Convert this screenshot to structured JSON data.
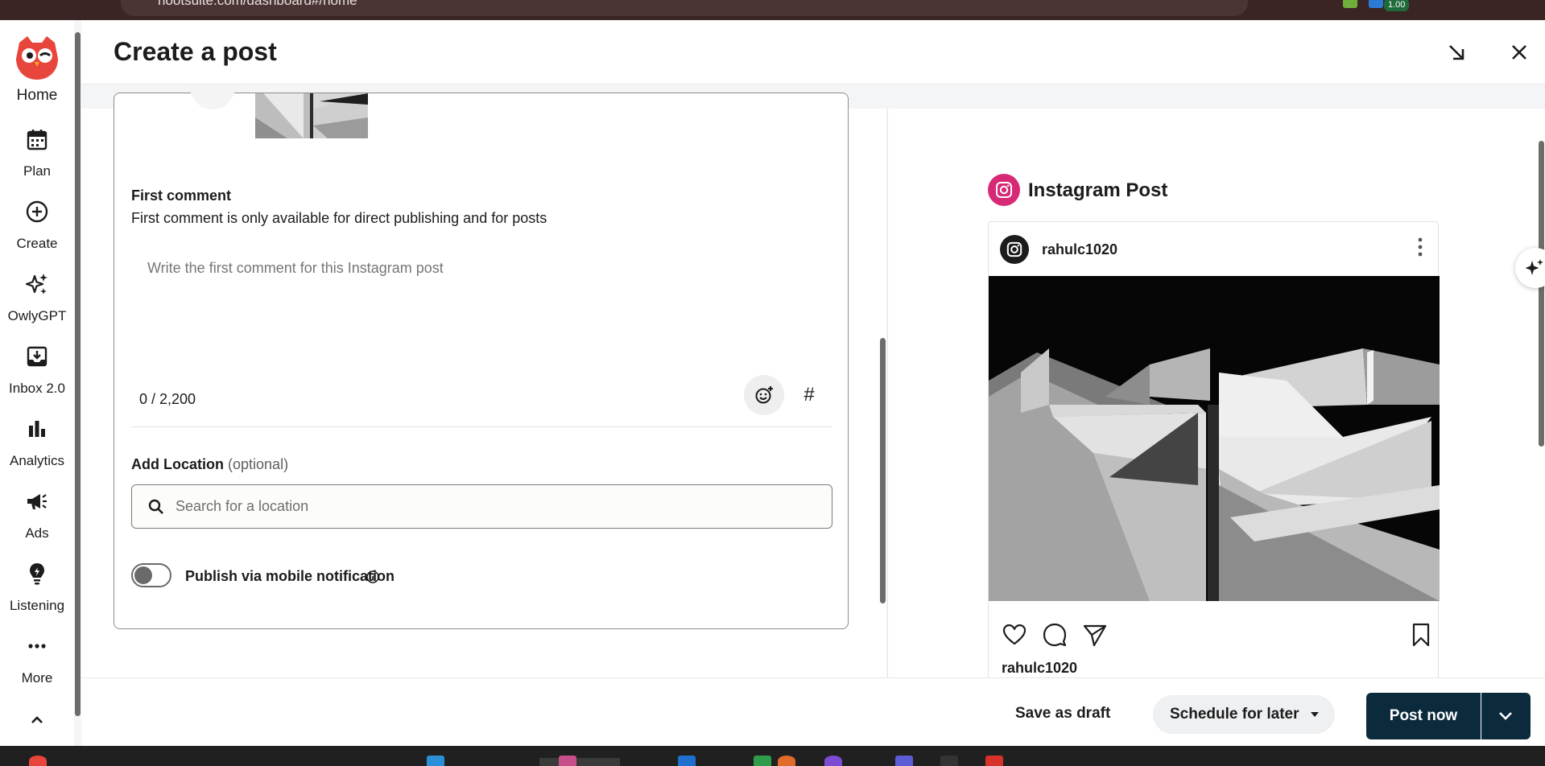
{
  "browser": {
    "url": "hootsuite.com/dashboard#/home",
    "extension_badge": "1.00"
  },
  "sidebar": {
    "items": [
      {
        "label": "Home",
        "icon": "owl-logo-icon"
      },
      {
        "label": "Plan",
        "icon": "calendar-icon"
      },
      {
        "label": "Create",
        "icon": "plus-circle-icon"
      },
      {
        "label": "OwlyGPT",
        "icon": "sparkle-icon"
      },
      {
        "label": "Inbox 2.0",
        "icon": "inbox-icon"
      },
      {
        "label": "Analytics",
        "icon": "bar-chart-icon"
      },
      {
        "label": "Ads",
        "icon": "megaphone-icon"
      },
      {
        "label": "Listening",
        "icon": "lightbulb-icon"
      },
      {
        "label": "More",
        "icon": "more-horizontal-icon"
      }
    ],
    "collapse_icon": "chevron-up-icon"
  },
  "header": {
    "title": "Create a post",
    "minimize_icon": "minimize-arrow-icon",
    "close_icon": "close-icon"
  },
  "editor": {
    "first_comment": {
      "label": "First comment",
      "helper": "First comment is only available for direct publishing and for posts",
      "placeholder": "Write the first comment for this Instagram post",
      "value": "",
      "counter": "0 / 2,200"
    },
    "hashtag_symbol": "#",
    "location": {
      "label": "Add Location",
      "optional": "(optional)",
      "placeholder": "Search for a location",
      "value": ""
    },
    "mobile_publish": {
      "label": "Publish via mobile notification",
      "enabled": false
    }
  },
  "preview": {
    "title": "Instagram Post",
    "username": "rahulc1020",
    "caption_username": "rahulc1020",
    "brand_color": "#d62976"
  },
  "footer": {
    "save_draft": "Save as draft",
    "schedule": "Schedule for later",
    "post_now": "Post now"
  },
  "colors": {
    "primary_button": "#0b2a3c",
    "schedule_button": "#eef0f2",
    "logo_red": "#e8453c"
  }
}
